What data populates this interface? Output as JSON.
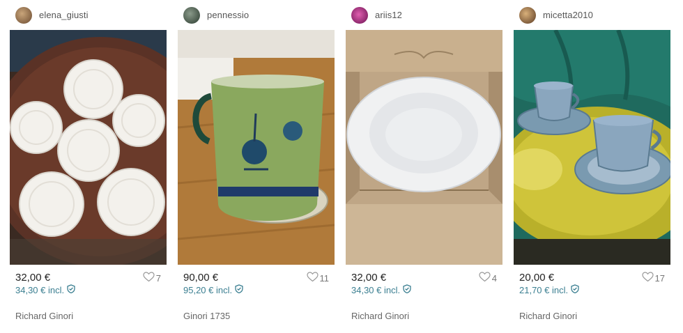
{
  "items": [
    {
      "username": "elena_giusti",
      "avatar_color": "#8a6a4a",
      "price": "32,00 €",
      "price_incl": "34,30 € incl.",
      "favorites": "7",
      "brand": "Richard Ginori",
      "icons": [
        "avatar",
        "heart-icon",
        "shield-check-icon"
      ]
    },
    {
      "username": "pennessio",
      "avatar_color": "#4a5a4a",
      "price": "90,00 €",
      "price_incl": "95,20 € incl.",
      "favorites": "11",
      "brand": "Ginori 1735",
      "icons": [
        "avatar",
        "heart-icon",
        "shield-check-icon"
      ]
    },
    {
      "username": "ariis12",
      "avatar_color": "#b0308a",
      "price": "32,00 €",
      "price_incl": "34,30 € incl.",
      "favorites": "4",
      "brand": "Richard Ginori",
      "icons": [
        "avatar",
        "heart-icon",
        "shield-check-icon"
      ]
    },
    {
      "username": "micetta2010",
      "avatar_color": "#7a5a3a",
      "price": "20,00 €",
      "price_incl": "21,70 € incl.",
      "favorites": "17",
      "brand": "Richard Ginori",
      "icons": [
        "avatar",
        "heart-icon",
        "shield-check-icon"
      ]
    }
  ],
  "colors": {
    "incl_price": "#3b7f91",
    "price": "#222222",
    "muted": "#666666"
  }
}
